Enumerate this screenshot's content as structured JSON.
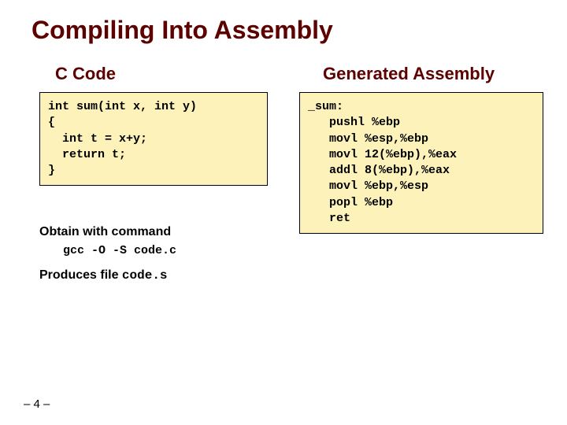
{
  "title": "Compiling Into Assembly",
  "left": {
    "header": "C Code",
    "code": "int sum(int x, int y)\n{\n  int t = x+y;\n  return t;\n}"
  },
  "right": {
    "header": "Generated Assembly",
    "code": "_sum:\n   pushl %ebp\n   movl %esp,%ebp\n   movl 12(%ebp),%eax\n   addl 8(%ebp),%eax\n   movl %ebp,%esp\n   popl %ebp\n   ret"
  },
  "obtain_label": "Obtain with command",
  "command": "gcc -O -S code.c",
  "produces_prefix": "Produces file ",
  "produces_file": "code.s",
  "page_number": "– 4 –"
}
